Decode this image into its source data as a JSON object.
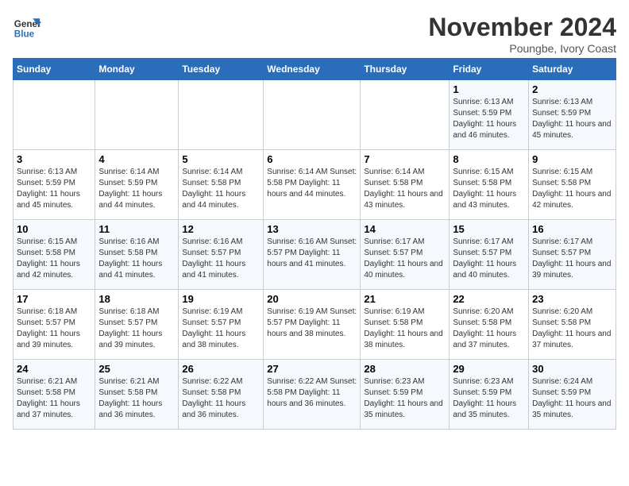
{
  "logo": {
    "line1": "General",
    "line2": "Blue"
  },
  "title": "November 2024",
  "subtitle": "Poungbe, Ivory Coast",
  "days_header": [
    "Sunday",
    "Monday",
    "Tuesday",
    "Wednesday",
    "Thursday",
    "Friday",
    "Saturday"
  ],
  "weeks": [
    [
      {
        "day": "",
        "info": ""
      },
      {
        "day": "",
        "info": ""
      },
      {
        "day": "",
        "info": ""
      },
      {
        "day": "",
        "info": ""
      },
      {
        "day": "",
        "info": ""
      },
      {
        "day": "1",
        "info": "Sunrise: 6:13 AM\nSunset: 5:59 PM\nDaylight: 11 hours and 46 minutes."
      },
      {
        "day": "2",
        "info": "Sunrise: 6:13 AM\nSunset: 5:59 PM\nDaylight: 11 hours and 45 minutes."
      }
    ],
    [
      {
        "day": "3",
        "info": "Sunrise: 6:13 AM\nSunset: 5:59 PM\nDaylight: 11 hours and 45 minutes."
      },
      {
        "day": "4",
        "info": "Sunrise: 6:14 AM\nSunset: 5:59 PM\nDaylight: 11 hours and 44 minutes."
      },
      {
        "day": "5",
        "info": "Sunrise: 6:14 AM\nSunset: 5:58 PM\nDaylight: 11 hours and 44 minutes."
      },
      {
        "day": "6",
        "info": "Sunrise: 6:14 AM\nSunset: 5:58 PM\nDaylight: 11 hours and 44 minutes."
      },
      {
        "day": "7",
        "info": "Sunrise: 6:14 AM\nSunset: 5:58 PM\nDaylight: 11 hours and 43 minutes."
      },
      {
        "day": "8",
        "info": "Sunrise: 6:15 AM\nSunset: 5:58 PM\nDaylight: 11 hours and 43 minutes."
      },
      {
        "day": "9",
        "info": "Sunrise: 6:15 AM\nSunset: 5:58 PM\nDaylight: 11 hours and 42 minutes."
      }
    ],
    [
      {
        "day": "10",
        "info": "Sunrise: 6:15 AM\nSunset: 5:58 PM\nDaylight: 11 hours and 42 minutes."
      },
      {
        "day": "11",
        "info": "Sunrise: 6:16 AM\nSunset: 5:58 PM\nDaylight: 11 hours and 41 minutes."
      },
      {
        "day": "12",
        "info": "Sunrise: 6:16 AM\nSunset: 5:57 PM\nDaylight: 11 hours and 41 minutes."
      },
      {
        "day": "13",
        "info": "Sunrise: 6:16 AM\nSunset: 5:57 PM\nDaylight: 11 hours and 41 minutes."
      },
      {
        "day": "14",
        "info": "Sunrise: 6:17 AM\nSunset: 5:57 PM\nDaylight: 11 hours and 40 minutes."
      },
      {
        "day": "15",
        "info": "Sunrise: 6:17 AM\nSunset: 5:57 PM\nDaylight: 11 hours and 40 minutes."
      },
      {
        "day": "16",
        "info": "Sunrise: 6:17 AM\nSunset: 5:57 PM\nDaylight: 11 hours and 39 minutes."
      }
    ],
    [
      {
        "day": "17",
        "info": "Sunrise: 6:18 AM\nSunset: 5:57 PM\nDaylight: 11 hours and 39 minutes."
      },
      {
        "day": "18",
        "info": "Sunrise: 6:18 AM\nSunset: 5:57 PM\nDaylight: 11 hours and 39 minutes."
      },
      {
        "day": "19",
        "info": "Sunrise: 6:19 AM\nSunset: 5:57 PM\nDaylight: 11 hours and 38 minutes."
      },
      {
        "day": "20",
        "info": "Sunrise: 6:19 AM\nSunset: 5:57 PM\nDaylight: 11 hours and 38 minutes."
      },
      {
        "day": "21",
        "info": "Sunrise: 6:19 AM\nSunset: 5:58 PM\nDaylight: 11 hours and 38 minutes."
      },
      {
        "day": "22",
        "info": "Sunrise: 6:20 AM\nSunset: 5:58 PM\nDaylight: 11 hours and 37 minutes."
      },
      {
        "day": "23",
        "info": "Sunrise: 6:20 AM\nSunset: 5:58 PM\nDaylight: 11 hours and 37 minutes."
      }
    ],
    [
      {
        "day": "24",
        "info": "Sunrise: 6:21 AM\nSunset: 5:58 PM\nDaylight: 11 hours and 37 minutes."
      },
      {
        "day": "25",
        "info": "Sunrise: 6:21 AM\nSunset: 5:58 PM\nDaylight: 11 hours and 36 minutes."
      },
      {
        "day": "26",
        "info": "Sunrise: 6:22 AM\nSunset: 5:58 PM\nDaylight: 11 hours and 36 minutes."
      },
      {
        "day": "27",
        "info": "Sunrise: 6:22 AM\nSunset: 5:58 PM\nDaylight: 11 hours and 36 minutes."
      },
      {
        "day": "28",
        "info": "Sunrise: 6:23 AM\nSunset: 5:59 PM\nDaylight: 11 hours and 35 minutes."
      },
      {
        "day": "29",
        "info": "Sunrise: 6:23 AM\nSunset: 5:59 PM\nDaylight: 11 hours and 35 minutes."
      },
      {
        "day": "30",
        "info": "Sunrise: 6:24 AM\nSunset: 5:59 PM\nDaylight: 11 hours and 35 minutes."
      }
    ]
  ]
}
